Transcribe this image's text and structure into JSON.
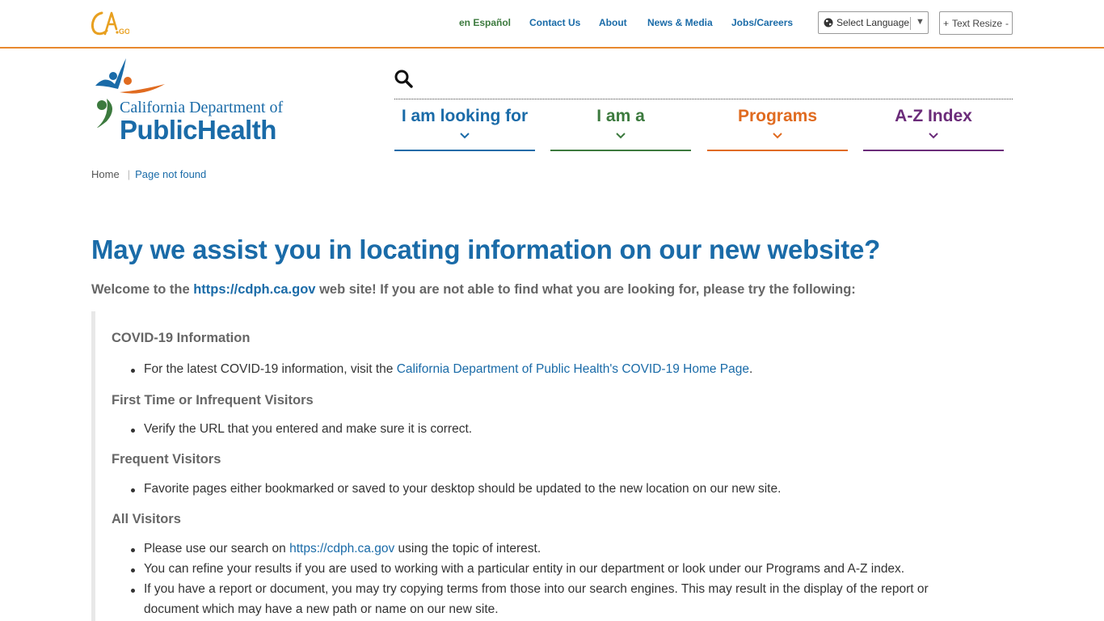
{
  "utility": {
    "ca_logo_text": "CA.GOV",
    "links": [
      {
        "label": "en Español",
        "key": "es"
      },
      {
        "label": "Contact Us",
        "key": "contact"
      },
      {
        "label": "About",
        "key": "about"
      },
      {
        "label": "News & Media",
        "key": "news"
      },
      {
        "label": "Jobs/Careers",
        "key": "jobs"
      }
    ],
    "select_language": "Select Language",
    "text_resize": "Text Resize"
  },
  "header": {
    "logo_line1": "California Department of",
    "logo_line2": "PublicHealth"
  },
  "nav": [
    {
      "label": "I am looking for",
      "color": "#1a6ba8"
    },
    {
      "label": "I am a",
      "color": "#3c7a3e"
    },
    {
      "label": "Programs",
      "color": "#e06b20"
    },
    {
      "label": "A-Z Index",
      "color": "#6b2c7a"
    }
  ],
  "breadcrumb": {
    "home": "Home",
    "current": "Page not found"
  },
  "main": {
    "title": "May we assist you in locating information on our new website?",
    "intro_before": "Welcome to the ",
    "intro_link": "https://cdph.ca.gov",
    "intro_after": " web site! If you are not able to find what you are looking for, please try the following:",
    "sections": {
      "covid_heading": "COVID-19 Information",
      "covid_text": "For the latest COVID-19 information, visit the ",
      "covid_link": "California Department of Public Health's COVID-19 Home Page",
      "covid_end": ".",
      "first_heading": "First Time or Infrequent Visitors",
      "first_text": " Verify the URL that you entered and make sure it is correct.",
      "frequent_heading": " Frequent Visitors",
      "frequent_text": "Favorite pages either bookmarked or saved to your desktop should be updated to the new location on our new site.",
      "all_heading": "All Visitors",
      "all_1_before": "Please use our search on ",
      "all_1_link": "https://cdph.ca.gov",
      "all_1_after": " using the topic of interest.",
      "all_2": "You can refine your results if you are used to working with a particular entity in our department or look under our Programs and A-Z index.",
      "all_3_line1": "If you have a report or document, you may try copying terms from those into our search engines. This may result in the display of the report or",
      "all_3_line2": "document which may have a new path or name on our new site."
    }
  }
}
